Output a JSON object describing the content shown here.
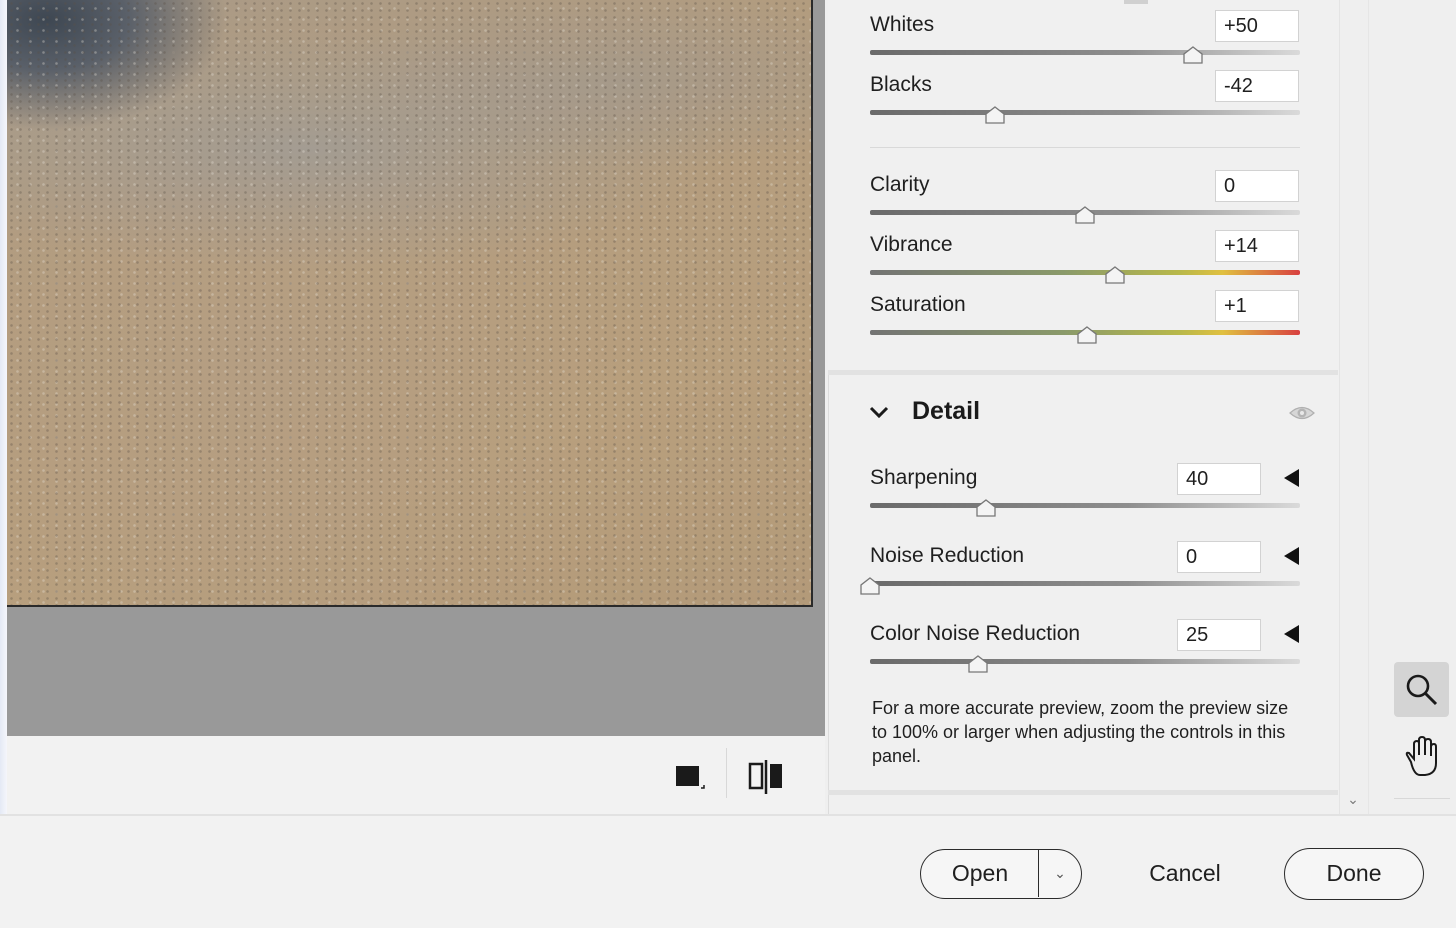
{
  "basic_sliders": [
    {
      "label": "Whites",
      "value": "+50",
      "level": 0.75,
      "style": "gray"
    },
    {
      "label": "Blacks",
      "value": "-42",
      "level": 0.29,
      "style": "gray"
    },
    {
      "label": "Clarity",
      "value": "0",
      "level": 0.5,
      "style": "gray"
    },
    {
      "label": "Vibrance",
      "value": "+14",
      "level": 0.57,
      "style": "color"
    },
    {
      "label": "Saturation",
      "value": "+1",
      "level": 0.505,
      "style": "color"
    }
  ],
  "detail": {
    "title": "Detail",
    "sliders": [
      {
        "label": "Sharpening",
        "value": "40",
        "level": 0.27
      },
      {
        "label": "Noise Reduction",
        "value": "0",
        "level": 0.0
      },
      {
        "label": "Color Noise Reduction",
        "value": "25",
        "level": 0.25
      }
    ],
    "note": "For a more accurate preview, zoom the preview size to 100% or larger when adjusting the controls in this panel."
  },
  "buttons": {
    "open": "Open",
    "cancel": "Cancel",
    "done": "Done"
  },
  "icons": [
    "single-view-icon",
    "before-after-compare-icon",
    "chevron-down-icon",
    "eye-icon",
    "zoom-tool-icon",
    "hand-tool-icon",
    "triangle-left-icon"
  ],
  "colors": {
    "accent": "#2b2b2b",
    "panel": "#f0f0f0",
    "preview_gray": "#999999"
  }
}
